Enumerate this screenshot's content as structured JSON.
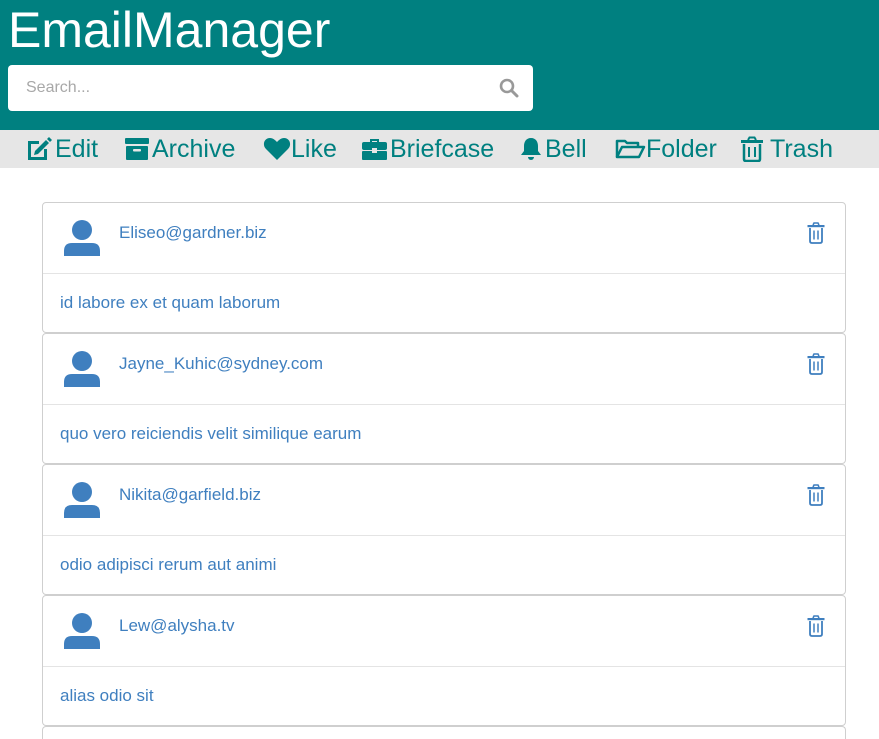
{
  "app": {
    "title": "EmailManager"
  },
  "search": {
    "placeholder": "Search..."
  },
  "toolbar": {
    "items": [
      {
        "label": "Edit",
        "icon": "edit-icon"
      },
      {
        "label": "Archive",
        "icon": "archive-icon"
      },
      {
        "label": "Like",
        "icon": "heart-icon"
      },
      {
        "label": "Briefcase",
        "icon": "briefcase-icon"
      },
      {
        "label": "Bell",
        "icon": "bell-icon"
      },
      {
        "label": "Folder",
        "icon": "folder-open-icon"
      },
      {
        "label": "Trash",
        "icon": "trash-icon"
      }
    ]
  },
  "emails": [
    {
      "sender": "Eliseo@gardner.biz",
      "subject": "id labore ex et quam laborum"
    },
    {
      "sender": "Jayne_Kuhic@sydney.com",
      "subject": "quo vero reiciendis velit similique earum"
    },
    {
      "sender": "Nikita@garfield.biz",
      "subject": "odio adipisci rerum aut animi"
    },
    {
      "sender": "Lew@alysha.tv",
      "subject": "alias odio sit"
    }
  ],
  "colors": {
    "header": "#008080",
    "toolbar_bg": "#e6e6e6",
    "accent": "#008080",
    "link_text": "#3f7fbf"
  }
}
